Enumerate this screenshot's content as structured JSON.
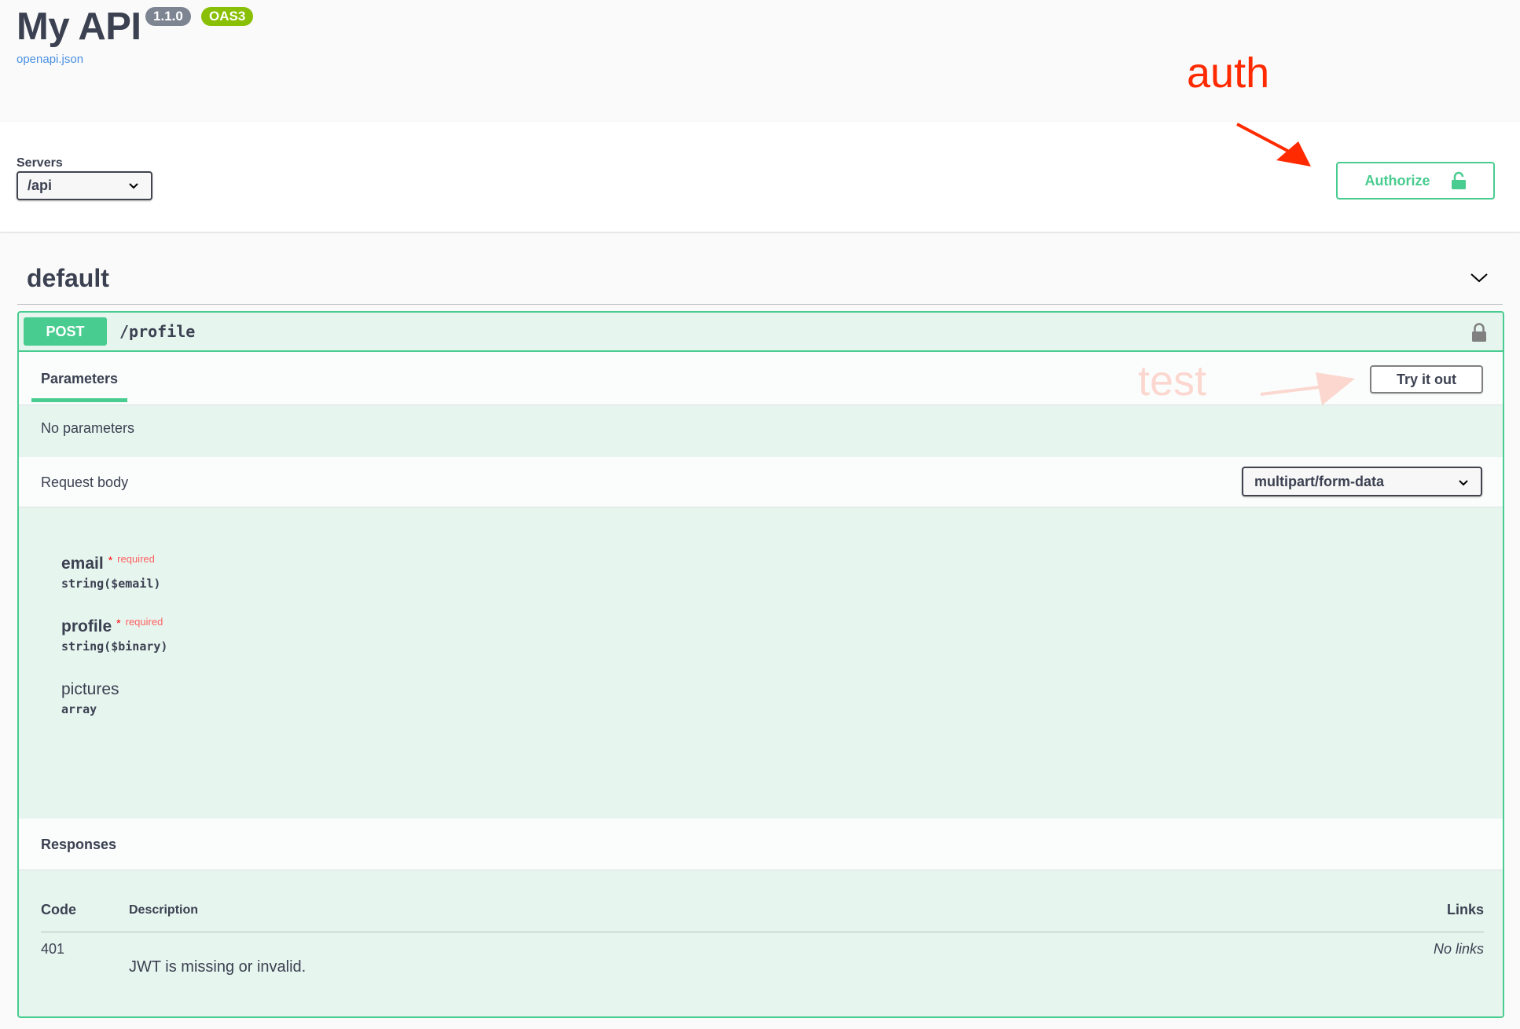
{
  "info": {
    "title": "My API",
    "version": "1.1.0",
    "spec_badge": "OAS3",
    "spec_link": "openapi.json"
  },
  "annotations": {
    "auth": "auth",
    "test": "test"
  },
  "servers": {
    "label": "Servers",
    "selected": "/api"
  },
  "authorize": {
    "label": "Authorize"
  },
  "tag": {
    "name": "default"
  },
  "operation": {
    "method": "POST",
    "path": "/profile",
    "parameters_tab": "Parameters",
    "try_it_out": "Try it out",
    "no_parameters": "No parameters",
    "request_body_label": "Request body",
    "content_type": "multipart/form-data",
    "properties": [
      {
        "name": "email",
        "required_marker": "*",
        "required_text": "required",
        "type": "string($email)"
      },
      {
        "name": "profile",
        "required_marker": "*",
        "required_text": "required",
        "type": "string($binary)"
      },
      {
        "name": "pictures",
        "type": "array"
      }
    ],
    "responses_label": "Responses",
    "responses_headers": {
      "code": "Code",
      "description": "Description",
      "links": "Links"
    },
    "responses": [
      {
        "code": "401",
        "description": "JWT is missing or invalid.",
        "links": "No links"
      }
    ]
  },
  "colors": {
    "post_green": "#49cc90",
    "annotation_red": "#ff2a00",
    "text": "#3b4151"
  }
}
